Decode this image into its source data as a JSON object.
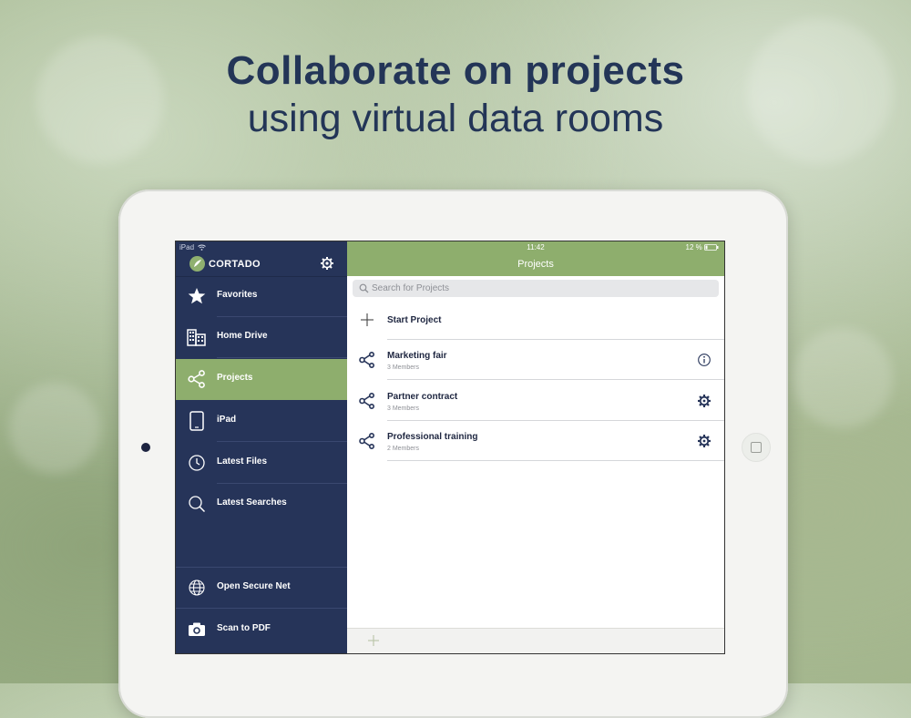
{
  "headline": {
    "title": "Collaborate on projects",
    "subtitle": "using virtual data rooms"
  },
  "sidebar": {
    "status_text": "iPad",
    "app_name": "CORTADO",
    "items": [
      {
        "label": "Favorites",
        "icon": "star-icon"
      },
      {
        "label": "Home Drive",
        "icon": "buildings-icon"
      },
      {
        "label": "Projects",
        "icon": "share-icon",
        "active": true
      },
      {
        "label": "iPad",
        "icon": "tablet-icon"
      },
      {
        "label": "Latest Files",
        "icon": "clock-icon"
      },
      {
        "label": "Latest Searches",
        "icon": "magnifier-icon"
      }
    ],
    "bottom_items": [
      {
        "label": "Open Secure Net",
        "icon": "globe-icon"
      },
      {
        "label": "Scan to PDF",
        "icon": "camera-icon"
      }
    ]
  },
  "main": {
    "time": "11:42",
    "battery": "12 %",
    "title": "Projects",
    "search_placeholder": "Search for Projects",
    "start_label": "Start Project",
    "projects": [
      {
        "name": "Marketing fair",
        "members": "3 Members",
        "action": "info-icon"
      },
      {
        "name": "Partner contract",
        "members": "3 Members",
        "action": "gear-icon"
      },
      {
        "name": "Professional training",
        "members": "2 Members",
        "action": "gear-icon"
      }
    ]
  },
  "colors": {
    "sidebar_bg": "#263459",
    "accent_green": "#8eae6d",
    "headline_text": "#233557"
  }
}
